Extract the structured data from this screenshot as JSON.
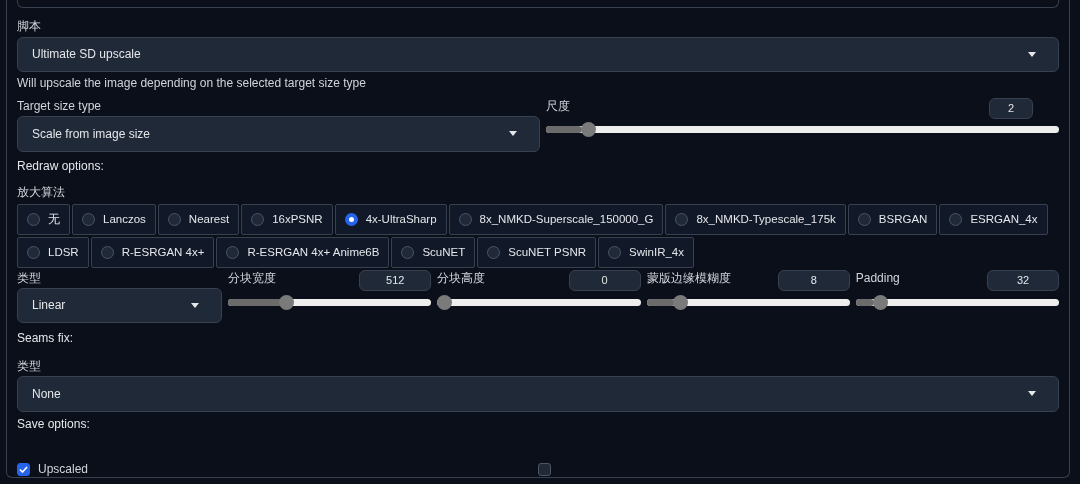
{
  "script": {
    "label": "脚本",
    "value": "Ultimate SD upscale",
    "hint": "Will upscale the image depending on the selected target size type"
  },
  "target_size": {
    "label": "Target size type",
    "value": "Scale from image size"
  },
  "scale": {
    "label": "尺度",
    "value": "2",
    "level": 0.07
  },
  "redraw_heading": "Redraw options:",
  "upscaler": {
    "label": "放大算法",
    "options": [
      {
        "label": "无",
        "selected": false
      },
      {
        "label": "Lanczos",
        "selected": false
      },
      {
        "label": "Nearest",
        "selected": false
      },
      {
        "label": "16xPSNR",
        "selected": false
      },
      {
        "label": "4x-UltraSharp",
        "selected": true
      },
      {
        "label": "8x_NMKD-Superscale_150000_G",
        "selected": false
      },
      {
        "label": "8x_NMKD-Typescale_175k",
        "selected": false
      },
      {
        "label": "BSRGAN",
        "selected": false
      },
      {
        "label": "ESRGAN_4x",
        "selected": false
      },
      {
        "label": "LDSR",
        "selected": false
      },
      {
        "label": "R-ESRGAN 4x+",
        "selected": false
      },
      {
        "label": "R-ESRGAN 4x+ Anime6B",
        "selected": false
      },
      {
        "label": "ScuNET",
        "selected": false
      },
      {
        "label": "ScuNET PSNR",
        "selected": false
      },
      {
        "label": "SwinIR_4x",
        "selected": false
      }
    ]
  },
  "type": {
    "label": "类型",
    "value": "Linear"
  },
  "sliders": [
    {
      "label": "分块宽度",
      "value": "512",
      "level": 0.27
    },
    {
      "label": "分块高度",
      "value": "0",
      "level": 0
    },
    {
      "label": "蒙版边缘模糊度",
      "value": "8",
      "level": 0.14
    },
    {
      "label": "Padding",
      "value": "32",
      "level": 0.09
    }
  ],
  "seams_heading": "Seams fix:",
  "seams_type": {
    "label": "类型",
    "value": "None"
  },
  "save_heading": "Save options:",
  "save_options": [
    {
      "label": "Upscaled",
      "checked": true
    },
    {
      "checked": false
    }
  ]
}
